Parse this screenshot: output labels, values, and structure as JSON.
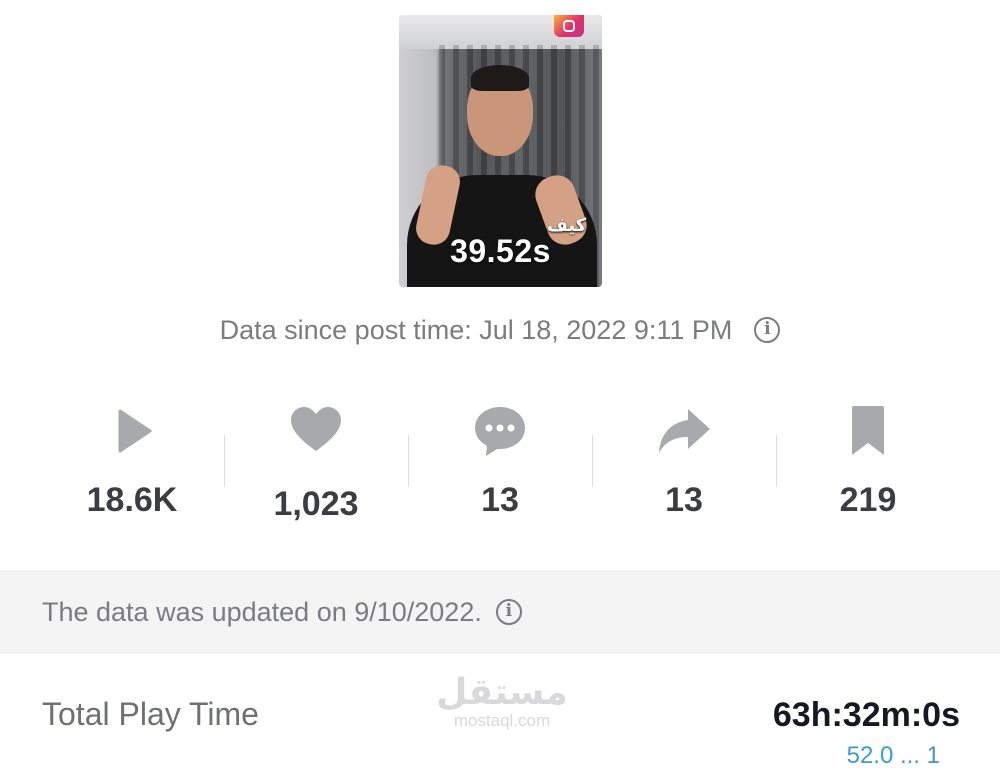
{
  "video": {
    "duration": "39.52s",
    "caption": "كيف"
  },
  "post_info": {
    "since_text": "Data since post time: Jul 18, 2022 9:11 PM",
    "info_icon": "info-icon"
  },
  "stats": [
    {
      "icon": "play-icon",
      "value": "18.6K"
    },
    {
      "icon": "heart-icon",
      "value": "1,023"
    },
    {
      "icon": "comment-icon",
      "value": "13"
    },
    {
      "icon": "share-icon",
      "value": "13"
    },
    {
      "icon": "bookmark-icon",
      "value": "219"
    }
  ],
  "update_notice": {
    "text": "The data was updated on 9/10/2022."
  },
  "total_play_time": {
    "label": "Total Play Time",
    "value": "63h:32m:0s",
    "sub_partial": "52.0 ... 1"
  },
  "watermark": {
    "arabic": "مستقل",
    "latin": "mostaql.com"
  },
  "colors": {
    "icon_gray": "#a8a9ad",
    "text_gray": "#7b7c80",
    "number_dark": "#3c3d42",
    "bar_bg": "#f4f4f5",
    "link_blue": "#3b99d6"
  }
}
